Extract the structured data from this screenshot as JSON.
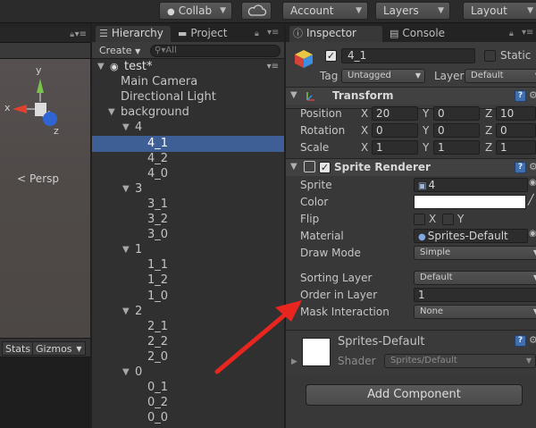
{
  "toolbar": {
    "collab_label": "Collab",
    "account_label": "Account",
    "layers_label": "Layers",
    "layout_label": "Layout"
  },
  "scene": {
    "gizmo_y": "y",
    "gizmo_x": "x",
    "gizmo_z": "z",
    "persp_label": "Persp",
    "stats_label": "Stats",
    "gizmos_label": "Gizmos"
  },
  "hierarchy": {
    "tab_label": "Hierarchy",
    "project_tab_label": "Project",
    "create_label": "Create",
    "search_placeholder": "All",
    "scene_name": "test*",
    "items": [
      {
        "label": "Main Camera",
        "depth": 1
      },
      {
        "label": "Directional Light",
        "depth": 1
      },
      {
        "label": "background",
        "depth": 1,
        "expanded": true
      },
      {
        "label": "4",
        "depth": 2,
        "expanded": true
      },
      {
        "label": "4_1",
        "depth": 3,
        "selected": true
      },
      {
        "label": "4_2",
        "depth": 3
      },
      {
        "label": "4_0",
        "depth": 3
      },
      {
        "label": "3",
        "depth": 2,
        "expanded": true
      },
      {
        "label": "3_1",
        "depth": 3
      },
      {
        "label": "3_2",
        "depth": 3
      },
      {
        "label": "3_0",
        "depth": 3
      },
      {
        "label": "1",
        "depth": 2,
        "expanded": true
      },
      {
        "label": "1_1",
        "depth": 3
      },
      {
        "label": "1_2",
        "depth": 3
      },
      {
        "label": "1_0",
        "depth": 3
      },
      {
        "label": "2",
        "depth": 2,
        "expanded": true
      },
      {
        "label": "2_1",
        "depth": 3
      },
      {
        "label": "2_2",
        "depth": 3
      },
      {
        "label": "2_0",
        "depth": 3
      },
      {
        "label": "0",
        "depth": 2,
        "expanded": true
      },
      {
        "label": "0_1",
        "depth": 3
      },
      {
        "label": "0_2",
        "depth": 3
      },
      {
        "label": "0_0",
        "depth": 3
      }
    ]
  },
  "inspector": {
    "tab_label": "Inspector",
    "console_tab_label": "Console",
    "object_name": "4_1",
    "static_label": "Static",
    "tag_label": "Tag",
    "tag_value": "Untagged",
    "layer_label": "Layer",
    "layer_value": "Default",
    "transform": {
      "title": "Transform",
      "position_label": "Position",
      "rotation_label": "Rotation",
      "scale_label": "Scale",
      "x_label": "X",
      "y_label": "Y",
      "z_label": "Z",
      "position": {
        "x": "20",
        "y": "0",
        "z": "10"
      },
      "rotation": {
        "x": "0",
        "y": "0",
        "z": "0"
      },
      "scale": {
        "x": "1",
        "y": "1",
        "z": "1"
      }
    },
    "sprite_renderer": {
      "title": "Sprite Renderer",
      "sprite_label": "Sprite",
      "sprite_value": "4",
      "color_label": "Color",
      "color_value": "#ffffff",
      "flip_label": "Flip",
      "flip_x_label": "X",
      "flip_y_label": "Y",
      "material_label": "Material",
      "material_value": "Sprites-Default",
      "draw_mode_label": "Draw Mode",
      "draw_mode_value": "Simple",
      "sorting_layer_label": "Sorting Layer",
      "sorting_layer_value": "Default",
      "order_in_layer_label": "Order in Layer",
      "order_in_layer_value": "1",
      "mask_interaction_label": "Mask Interaction",
      "mask_interaction_value": "None"
    },
    "material": {
      "name": "Sprites-Default",
      "shader_label": "Shader",
      "shader_value": "Sprites/Default"
    },
    "add_component_label": "Add Component"
  },
  "colors": {
    "selection": "#3e5f96",
    "annotation_arrow": "#e8261f",
    "help_icon": "#3f6fb0"
  }
}
